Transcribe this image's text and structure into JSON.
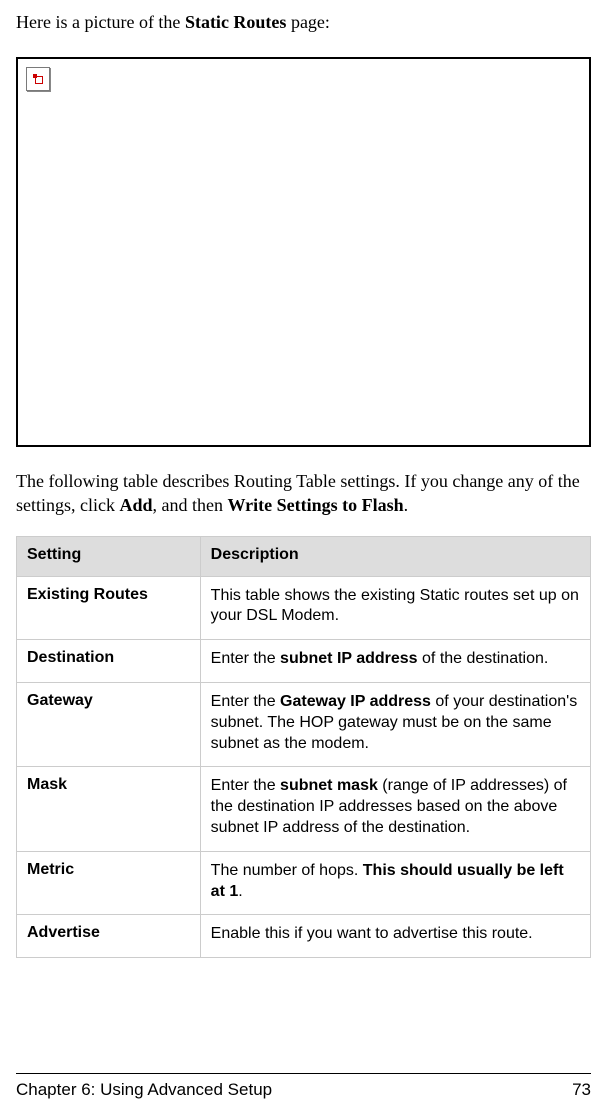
{
  "intro": {
    "prefix": "Here is a picture of the ",
    "bold": "Static Routes",
    "suffix": " page:"
  },
  "desc": {
    "line1": "The following table describes Routing Table settings. If you change any of the settings, click ",
    "bold1": "Add",
    "mid": ", and then ",
    "bold2": "Write Settings to Flash",
    "end": "."
  },
  "table": {
    "header": {
      "setting": "Setting",
      "description": "Description"
    },
    "rows": [
      {
        "name": "Existing Routes",
        "desc_plain": "This table shows the existing Static routes set up on your DSL Modem."
      },
      {
        "name": "Destination",
        "desc_pre": "Enter the ",
        "desc_bold": "subnet IP address",
        "desc_post": " of the destination."
      },
      {
        "name": "Gateway",
        "desc_pre": "Enter the ",
        "desc_bold": "Gateway IP address",
        "desc_post": " of your destination's subnet. The HOP gateway must be on the same subnet as the modem."
      },
      {
        "name": "Mask",
        "desc_pre": "Enter the ",
        "desc_bold": "subnet mask",
        "desc_post": " (range of IP addresses) of the destination IP addresses based on the above subnet IP address of the destination."
      },
      {
        "name": "Metric",
        "desc_pre": "The number of hops. ",
        "desc_bold": "This should usually be left at 1",
        "desc_post": "."
      },
      {
        "name": "Advertise",
        "desc_plain": "Enable this if you want to advertise this route."
      }
    ]
  },
  "footer": {
    "chapter": "Chapter 6: Using Advanced Setup",
    "page": "73"
  }
}
